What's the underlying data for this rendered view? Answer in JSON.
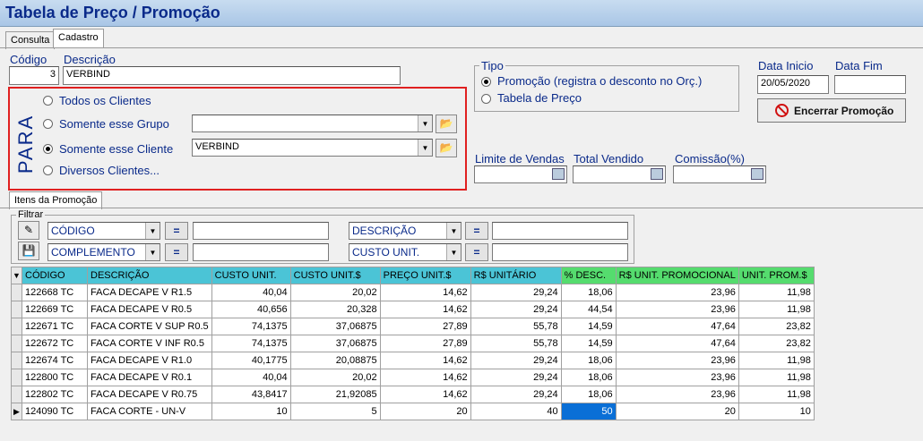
{
  "window": {
    "title": "Tabela de Preço / Promoção"
  },
  "tabs": [
    {
      "label": "Consulta"
    },
    {
      "label": "Cadastro"
    }
  ],
  "header": {
    "codigo_label": "Código",
    "codigo_value": "3",
    "descricao_label": "Descrição",
    "descricao_value": "VERBIND"
  },
  "para": {
    "title": "PARA",
    "options": [
      {
        "label": "Todos os Clientes",
        "selected": false
      },
      {
        "label": "Somente esse Grupo",
        "selected": false
      },
      {
        "label": "Somente esse Cliente",
        "selected": true
      },
      {
        "label": "Diversos Clientes...",
        "selected": false
      }
    ],
    "grupo_value": "",
    "cliente_value": "VERBIND"
  },
  "tipo": {
    "title": "Tipo",
    "options": [
      {
        "label": "Promoção (registra o desconto no Orç.)",
        "selected": true
      },
      {
        "label": "Tabela de Preço",
        "selected": false
      }
    ]
  },
  "datas": {
    "inicio_label": "Data Inicio",
    "inicio_value": "20/05/2020",
    "fim_label": "Data Fim",
    "fim_value": "",
    "encerrar_label": "Encerrar Promoção"
  },
  "limites": {
    "limite_label": "Limite de Vendas",
    "total_label": "Total Vendido",
    "comissao_label": "Comissão(%)"
  },
  "itens_tab": {
    "label": "Itens da Promoção"
  },
  "filtrar": {
    "title": "Filtrar",
    "row1": {
      "field1": "CÓDIGO",
      "op1": "=",
      "field2": "DESCRIÇÃO",
      "op2": "="
    },
    "row2": {
      "field1": "COMPLEMENTO",
      "op1": "=",
      "field2": "CUSTO UNIT.",
      "op2": "="
    }
  },
  "grid": {
    "columns": [
      "CÓDIGO",
      "DESCRIÇÃO",
      "CUSTO UNIT.",
      "CUSTO UNIT.$",
      "PREÇO UNIT.$",
      "R$ UNITÁRIO",
      "% DESC.",
      "R$ UNIT. PROMOCIONAL",
      "UNIT. PROM.$"
    ],
    "rows": [
      [
        "122668 TC",
        "FACA DECAPE V R1.5",
        "40,04",
        "20,02",
        "14,62",
        "29,24",
        "18,06",
        "23,96",
        "11,98"
      ],
      [
        "122669 TC",
        "FACA DECAPE V R0.5",
        "40,656",
        "20,328",
        "14,62",
        "29,24",
        "44,54",
        "23,96",
        "11,98"
      ],
      [
        "122671 TC",
        "FACA CORTE V SUP R0.5",
        "74,1375",
        "37,06875",
        "27,89",
        "55,78",
        "14,59",
        "47,64",
        "23,82"
      ],
      [
        "122672 TC",
        "FACA CORTE V INF R0.5",
        "74,1375",
        "37,06875",
        "27,89",
        "55,78",
        "14,59",
        "47,64",
        "23,82"
      ],
      [
        "122674 TC",
        "FACA DECAPE V R1.0",
        "40,1775",
        "20,08875",
        "14,62",
        "29,24",
        "18,06",
        "23,96",
        "11,98"
      ],
      [
        "122800 TC",
        "FACA DECAPE V R0.1",
        "40,04",
        "20,02",
        "14,62",
        "29,24",
        "18,06",
        "23,96",
        "11,98"
      ],
      [
        "122802 TC",
        "FACA DECAPE V R0.75",
        "43,8417",
        "21,92085",
        "14,62",
        "29,24",
        "18,06",
        "23,96",
        "11,98"
      ],
      [
        "124090 TC",
        "FACA CORTE - UN-V",
        "10",
        "5",
        "20",
        "40",
        "50",
        "20",
        "10"
      ]
    ]
  }
}
